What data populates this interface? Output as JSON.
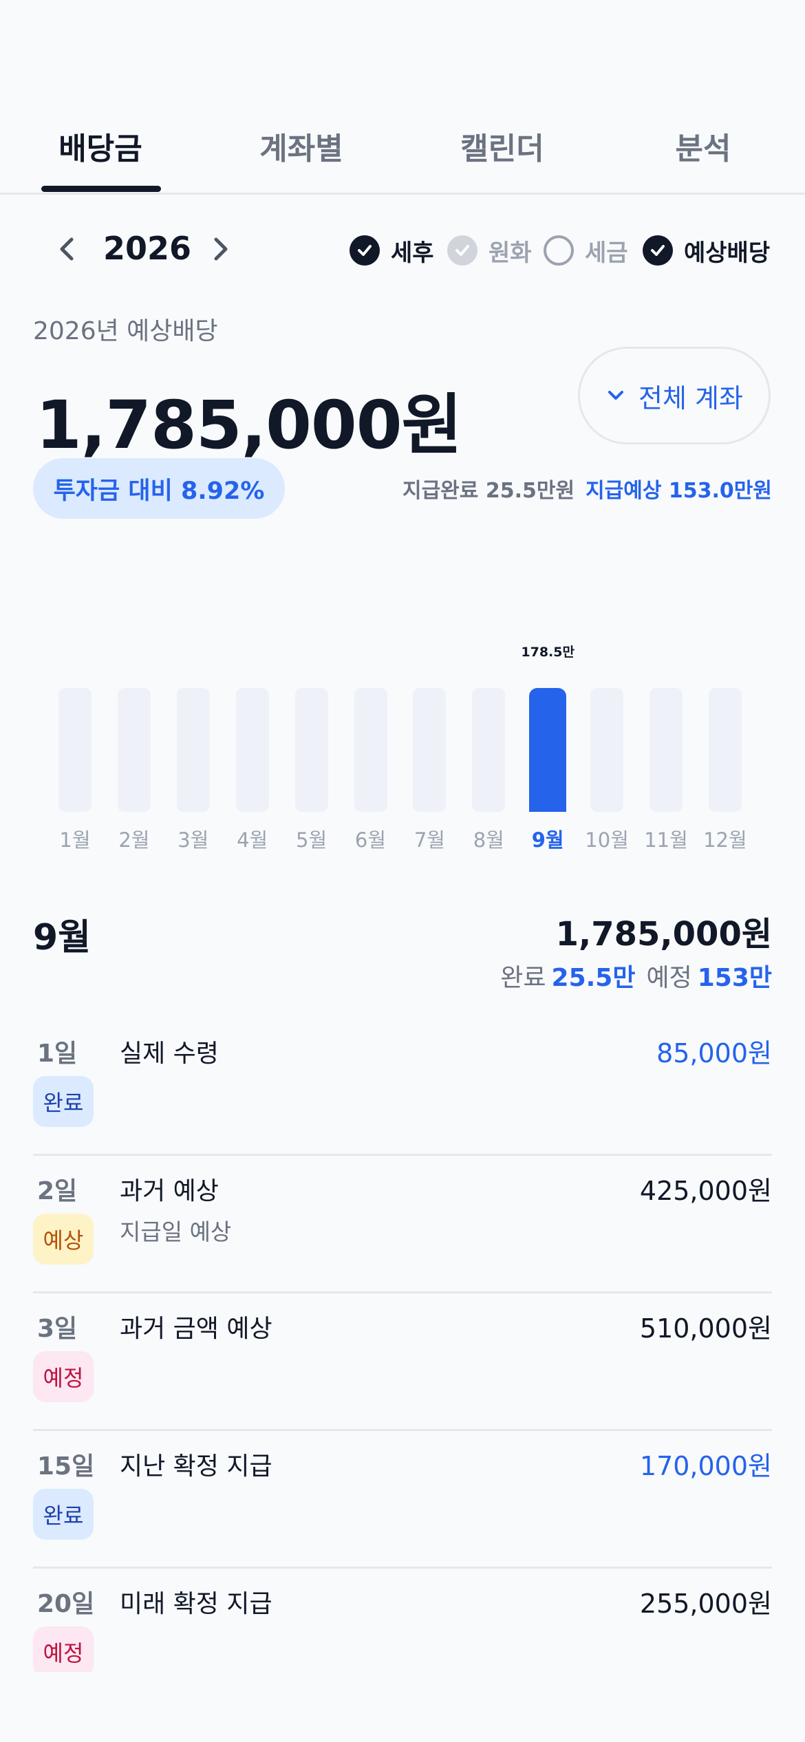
{
  "tabs": [
    "배당금",
    "계좌별",
    "캘린더",
    "분석"
  ],
  "year": "2026",
  "filters": [
    {
      "label": "세후",
      "state": "on"
    },
    {
      "label": "원화",
      "state": "faint"
    },
    {
      "label": "세금",
      "state": "off"
    },
    {
      "label": "예상배당",
      "state": "on"
    }
  ],
  "summary": {
    "sublabel": "2026년 예상배당",
    "total": "1,785,000원",
    "account_button": "전체 계좌",
    "ratio": "투자금 대비 8.92%",
    "paid": "지급완료 25.5만원",
    "planned": "지급예상 153.0만원"
  },
  "chart_data": {
    "type": "bar",
    "categories": [
      "1월",
      "2월",
      "3월",
      "4월",
      "5월",
      "6월",
      "7월",
      "8월",
      "9월",
      "10월",
      "11월",
      "12월"
    ],
    "values": [
      0,
      0,
      0,
      0,
      0,
      0,
      0,
      0,
      178.5,
      0,
      0,
      0
    ],
    "selected_index": 8,
    "value_labels": {
      "8": "178.5만"
    },
    "ylim": [
      0,
      178.5
    ],
    "colors": {
      "selected": "#2563eb",
      "track": "#eef2f8"
    }
  },
  "month": {
    "title": "9월",
    "total": "1,785,000원",
    "done_label": "완료",
    "done_value": "25.5만",
    "sched_label": "예정",
    "sched_value": "153만"
  },
  "items": [
    {
      "day": "1일",
      "badge": "완료",
      "badge_type": "done",
      "name": "실제 수령",
      "note": "",
      "amount": "85,000원",
      "amount_blue": true
    },
    {
      "day": "2일",
      "badge": "예상",
      "badge_type": "est",
      "name": "과거 예상",
      "note": "지급일 예상",
      "amount": "425,000원",
      "amount_blue": false
    },
    {
      "day": "3일",
      "badge": "예정",
      "badge_type": "sched",
      "name": "과거 금액 예상",
      "note": "",
      "amount": "510,000원",
      "amount_blue": false
    },
    {
      "day": "15일",
      "badge": "완료",
      "badge_type": "done",
      "name": "지난 확정 지급",
      "note": "",
      "amount": "170,000원",
      "amount_blue": true
    },
    {
      "day": "20일",
      "badge": "예정",
      "badge_type": "sched",
      "name": "미래 확정 지급",
      "note": "",
      "amount": "255,000원",
      "amount_blue": false
    }
  ]
}
